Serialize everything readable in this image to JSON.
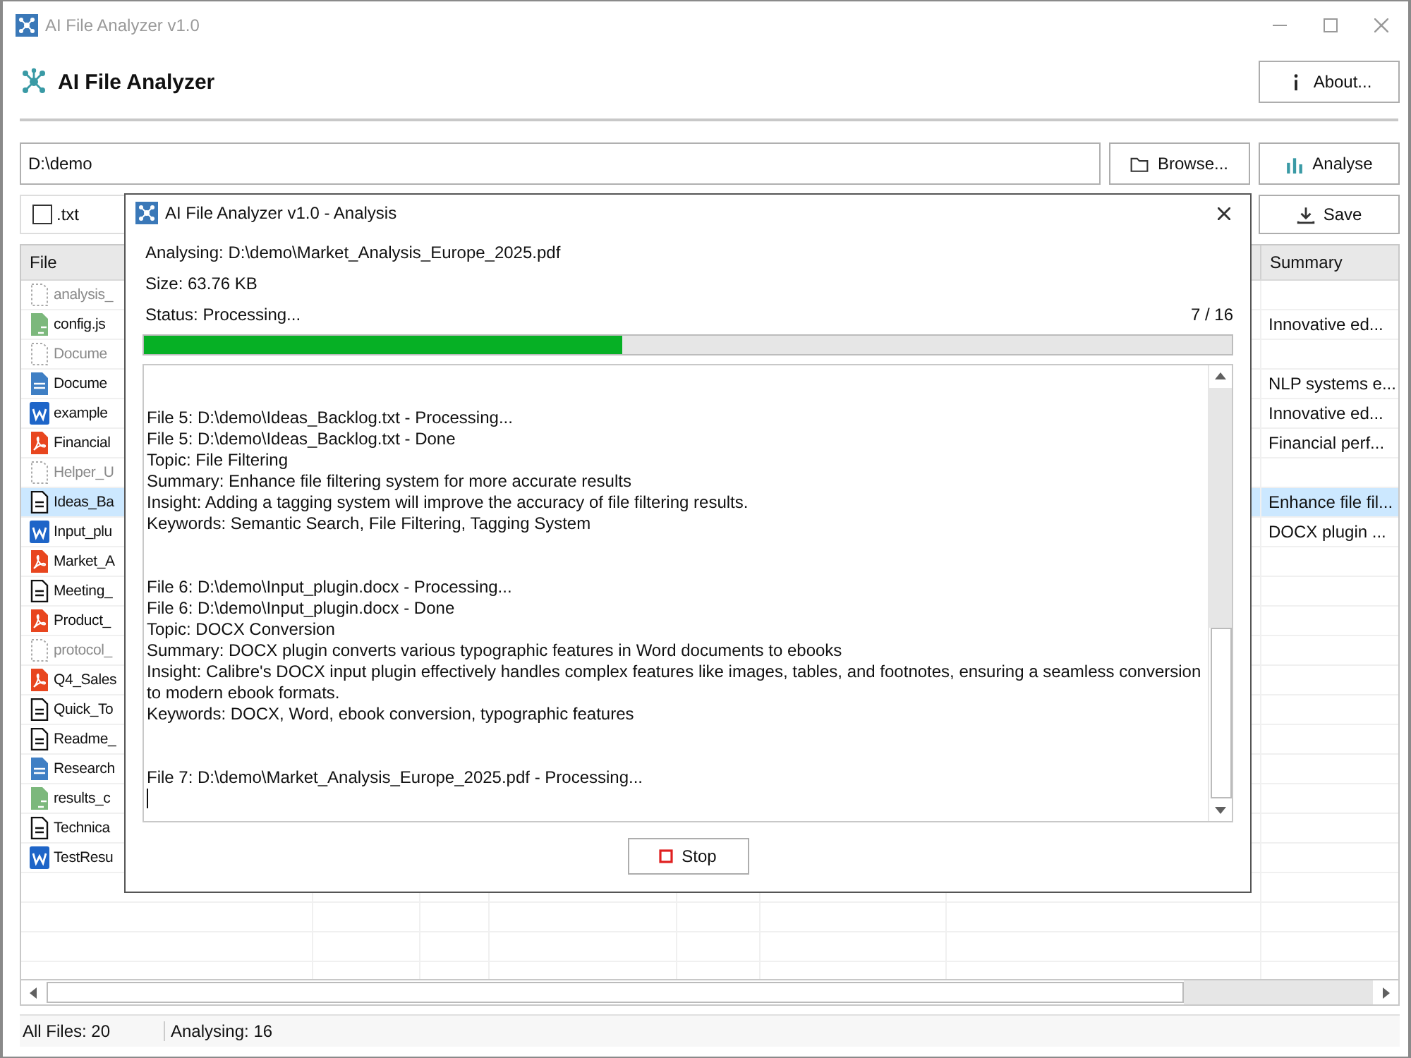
{
  "window": {
    "title": "AI File Analyzer v1.0"
  },
  "header": {
    "title": "AI File Analyzer",
    "about_button": "About..."
  },
  "path_field": {
    "value": "D:\\demo"
  },
  "buttons": {
    "browse": "Browse...",
    "analyse": "Analyse",
    "save": "Save"
  },
  "filter": {
    "label": ".txt",
    "checked": false
  },
  "table": {
    "columns": [
      "File",
      "Summary"
    ],
    "rows": [
      {
        "kind": "missing",
        "name": "analysis_",
        "selected": false
      },
      {
        "kind": "json",
        "name": "config.js",
        "summary": "Innovative ed...",
        "selected": false
      },
      {
        "kind": "missing",
        "name": "Docume",
        "selected": false
      },
      {
        "kind": "doc",
        "name": "Docume",
        "summary": "NLP systems e...",
        "selected": false
      },
      {
        "kind": "word",
        "name": "example",
        "summary": "Innovative ed...",
        "selected": false
      },
      {
        "kind": "pdf",
        "name": "Financial",
        "summary": "Financial perf...",
        "selected": false
      },
      {
        "kind": "missing",
        "name": "Helper_U",
        "selected": false
      },
      {
        "kind": "text",
        "name": "Ideas_Ba",
        "summary": "Enhance file fil...",
        "selected": true
      },
      {
        "kind": "word",
        "name": "Input_plu",
        "summary": "DOCX plugin ...",
        "selected": false
      },
      {
        "kind": "pdf",
        "name": "Market_A",
        "selected": false
      },
      {
        "kind": "text",
        "name": "Meeting_",
        "selected": false
      },
      {
        "kind": "pdf",
        "name": "Product_",
        "selected": false
      },
      {
        "kind": "missing",
        "name": "protocol_",
        "selected": false
      },
      {
        "kind": "pdf",
        "name": "Q4_Sales",
        "selected": false
      },
      {
        "kind": "text",
        "name": "Quick_To",
        "selected": false
      },
      {
        "kind": "text",
        "name": "Readme_",
        "selected": false
      },
      {
        "kind": "doc",
        "name": "Research",
        "selected": false
      },
      {
        "kind": "json",
        "name": "results_c",
        "selected": false
      },
      {
        "kind": "text",
        "name": "Technica",
        "selected": false
      },
      {
        "kind": "word",
        "name": "TestResu",
        "selected": false
      }
    ]
  },
  "status_bar": {
    "all_files": "All Files: 20",
    "analysing": "Analysing: 16"
  },
  "dialog": {
    "title": "AI File Analyzer v1.0 - Analysis",
    "analysing": "Analysing: D:\\demo\\Market_Analysis_Europe_2025.pdf",
    "size": "Size: 63.76 KB",
    "status": "Status: Processing...",
    "count": "7 / 16",
    "progress": {
      "level": 0.44
    },
    "log": [
      [
        "File 5: D:\\demo\\Ideas_Backlog.txt - Processing...",
        "File 5: D:\\demo\\Ideas_Backlog.txt - Done",
        "Topic: File Filtering",
        "Summary: Enhance file filtering system for more accurate results",
        "Insight: Adding a tagging system will improve the accuracy of file filtering results.",
        "Keywords: Semantic Search, File Filtering, Tagging System"
      ],
      [
        "File 6: D:\\demo\\Input_plugin.docx - Processing...",
        "File 6: D:\\demo\\Input_plugin.docx - Done",
        "Topic: DOCX Conversion",
        "Summary: DOCX plugin converts various typographic features in Word documents to ebooks",
        "Insight: Calibre's DOCX input plugin effectively handles complex features like images, tables, and footnotes, ensuring a seamless conversion to modern ebook formats.",
        "Keywords: DOCX, Word, ebook conversion, typographic features"
      ],
      [
        "File 7: D:\\demo\\Market_Analysis_Europe_2025.pdf - Processing..."
      ]
    ],
    "stop_button": "Stop"
  }
}
